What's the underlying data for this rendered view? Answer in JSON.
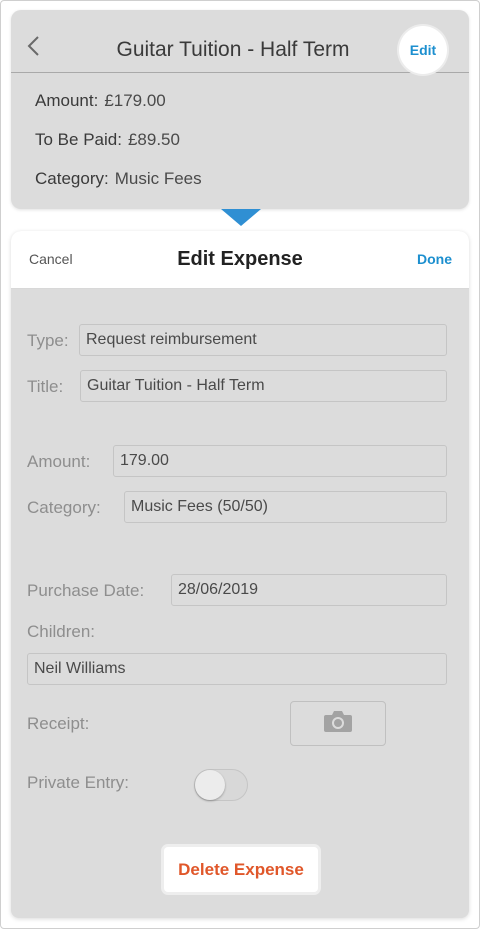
{
  "summary": {
    "title": "Guitar Tuition - Half Term",
    "edit_label": "Edit",
    "amount_label": "Amount:",
    "amount_value": "£179.00",
    "to_be_paid_label": "To Be Paid:",
    "to_be_paid_value": "£89.50",
    "category_label": "Category:",
    "category_value": "Music Fees"
  },
  "sheet": {
    "cancel_label": "Cancel",
    "title": "Edit Expense",
    "done_label": "Done",
    "type_label": "Type:",
    "type_value": "Request reimbursement",
    "title_label": "Title:",
    "title_value": "Guitar Tuition - Half Term",
    "amount_label": "Amount:",
    "amount_value": "179.00",
    "category_label": "Category:",
    "category_value": "Music Fees (50/50)",
    "purchase_date_label": "Purchase Date:",
    "purchase_date_value": "28/06/2019",
    "children_label": "Children:",
    "children_value": "Neil Williams",
    "receipt_label": "Receipt:",
    "receipt_icon": "camera-icon",
    "private_entry_label": "Private Entry:",
    "private_entry_on": false,
    "delete_label": "Delete Expense"
  },
  "colors": {
    "accent": "#1c8fcf",
    "danger": "#e0572a",
    "pointer": "#2f8fd3",
    "card_bg": "#dcdcdc"
  }
}
